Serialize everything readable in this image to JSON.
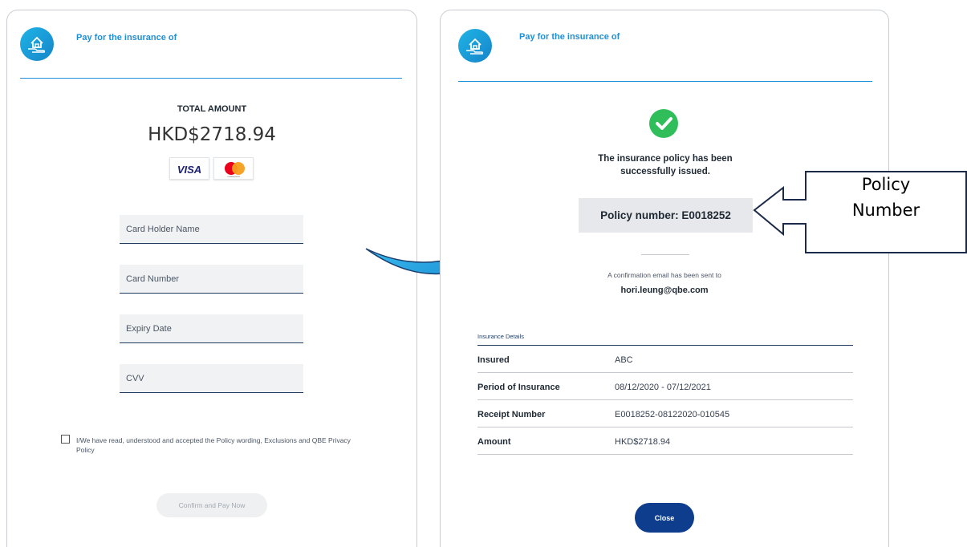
{
  "left_panel": {
    "header_title": "Pay for the insurance of",
    "total_label": "TOTAL AMOUNT",
    "total_amount": "HKD$2718.94",
    "card_brands": [
      "VISA",
      "mastercard"
    ],
    "fields": [
      {
        "placeholder": "Card Holder Name"
      },
      {
        "placeholder": "Card Number"
      },
      {
        "placeholder": "Expiry Date"
      },
      {
        "placeholder": "CVV"
      }
    ],
    "consent_text": "I/We have read, understood and accepted the Policy wording, Exclusions and QBE Privacy Policy",
    "pay_button": "Confirm and Pay Now"
  },
  "right_panel": {
    "header_title": "Pay for the insurance of",
    "success_line1": "The insurance policy has been",
    "success_line2": "successfully issued.",
    "policy_number_text": "Policy number: E0018252",
    "email_note": "A confirmation email has been sent to",
    "email": "hori.leung@qbe.com",
    "details_title": "Insurance Details",
    "details": [
      {
        "label": "Insured",
        "value": "ABC"
      },
      {
        "label": "Period of Insurance",
        "value": "08/12/2020 - 07/12/2021"
      },
      {
        "label": "Receipt Number",
        "value": "E0018252-08122020-010545"
      },
      {
        "label": "Amount",
        "value": "HKD$2718.94"
      }
    ],
    "close_button": "Close"
  },
  "callout": {
    "line1": "Policy",
    "line2": "Number"
  },
  "colors": {
    "accent": "#1f8fd8",
    "navy": "#0d3d8c",
    "success": "#2fbe5a",
    "arrow": "#1fa0e0"
  }
}
